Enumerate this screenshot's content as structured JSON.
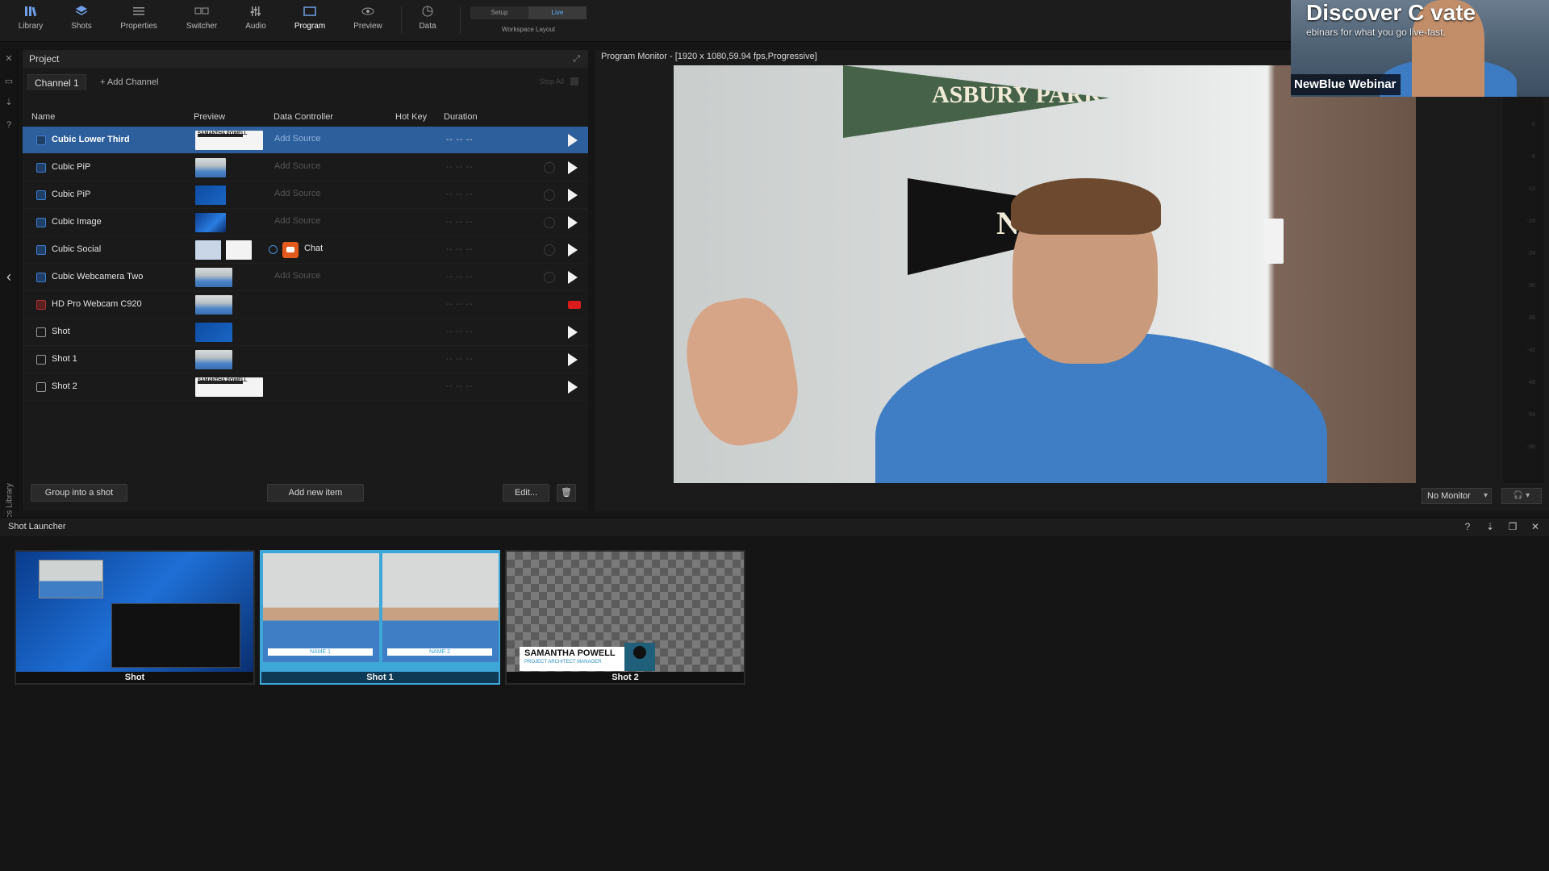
{
  "toolbar": {
    "items": [
      {
        "label": "Library",
        "icon": "library-icon"
      },
      {
        "label": "Shots",
        "icon": "shots-icon"
      },
      {
        "label": "Properties",
        "icon": "properties-icon"
      },
      {
        "label": "Switcher",
        "icon": "switcher-icon"
      },
      {
        "label": "Audio",
        "icon": "audio-icon"
      },
      {
        "label": "Program",
        "icon": "program-icon"
      },
      {
        "label": "Preview",
        "icon": "preview-icon"
      },
      {
        "label": "Data",
        "icon": "data-icon"
      }
    ],
    "layout_setup": "Setup",
    "layout_live": "Live",
    "layout_label": "Workspace Layout"
  },
  "left_rail": {
    "vertical_label": "Graphics Library"
  },
  "project": {
    "title": "Project",
    "channel_tab": "Channel 1",
    "add_channel": "+ Add Channel",
    "stop_all": "Stop All",
    "columns": {
      "name": "Name",
      "preview": "Preview",
      "data_controller": "Data Controller",
      "hot_key": "Hot Key",
      "duration": "Duration"
    },
    "rows": [
      {
        "name": "Cubic Lower Third",
        "source": "Add Source",
        "duration": "-- -- --",
        "selected": true,
        "preview": "lower-third"
      },
      {
        "name": "Cubic PiP",
        "source": "Add Source",
        "duration": "-- -- --",
        "preview": "person"
      },
      {
        "name": "Cubic PiP",
        "source": "Add Source",
        "duration": "-- -- --",
        "preview": "screen"
      },
      {
        "name": "Cubic Image",
        "source": "Add Source",
        "duration": "-- -- --",
        "preview": "blue"
      },
      {
        "name": "Cubic Social",
        "source": "Chat",
        "duration": "-- -- --",
        "preview": "social"
      },
      {
        "name": "Cubic Webcamera Two",
        "source": "Add Source",
        "duration": "-- -- --",
        "preview": "person"
      },
      {
        "name": "HD Pro Webcam C920",
        "source": "",
        "duration": "-- -- --",
        "preview": "person"
      },
      {
        "name": "Shot",
        "source": "",
        "duration": "-- -- --",
        "preview": "screen"
      },
      {
        "name": "Shot 1",
        "source": "",
        "duration": "-- -- --",
        "preview": "person"
      },
      {
        "name": "Shot 2",
        "source": "",
        "duration": "-- -- --",
        "preview": "lower-third"
      }
    ],
    "preview_lower_third_name": "SAMANTHA POWELL",
    "buttons": {
      "group": "Group into a shot",
      "add_new": "Add new item",
      "edit": "Edit..."
    }
  },
  "monitor": {
    "title": "Program Monitor - [1920 x 1080,59.94 fps,Progressive]",
    "pennant1_text": "ASBURY PARK",
    "pennant2_text": "N",
    "no_monitor": "No Monitor",
    "meter_ticks": [
      "0",
      "-6",
      "-12",
      "-18",
      "-24",
      "-30",
      "-36",
      "-42",
      "-48",
      "-54",
      "-60"
    ]
  },
  "overlay": {
    "title": "Discover C   vate",
    "subtitle": "ebinars for what you     go live-fast.",
    "brand": "NewBlue Webinar"
  },
  "launcher": {
    "title": "Shot Launcher",
    "shots": [
      {
        "label": "Shot",
        "active": false
      },
      {
        "label": "Shot 1",
        "active": true
      },
      {
        "label": "Shot 2",
        "active": false
      }
    ],
    "name_bar_1": "NAME 1",
    "name_bar_2": "NAME 2",
    "lower_third_name": "SAMANTHA POWELL",
    "lower_third_role": "PROJECT ARCHITECT MANAGER"
  }
}
